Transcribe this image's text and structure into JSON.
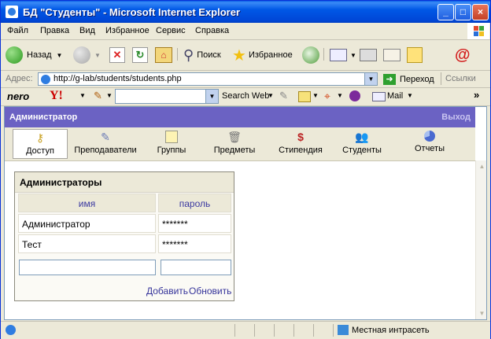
{
  "window": {
    "title": "БД \"Студенты\" - Microsoft Internet Explorer"
  },
  "menu": [
    "Файл",
    "Правка",
    "Вид",
    "Избранное",
    "Сервис",
    "Справка"
  ],
  "toolbar": {
    "back": "Назад",
    "search": "Поиск",
    "favorites": "Избранное"
  },
  "address": {
    "label": "Адрес:",
    "url": "http://g-lab/students/students.php",
    "go": "Переход",
    "links": "Ссылки"
  },
  "toolbar3": {
    "nero": "nero",
    "yahoo": "Y!",
    "search_web": "Search Web",
    "mail": "Mail"
  },
  "page": {
    "header": {
      "user": "Администратор",
      "logout": "Выход"
    },
    "nav": [
      {
        "label": "Доступ",
        "icon": "keys-icon"
      },
      {
        "label": "Преподаватели",
        "icon": "pencil-icon"
      },
      {
        "label": "Группы",
        "icon": "calendar-icon"
      },
      {
        "label": "Предметы",
        "icon": "trash-icon"
      },
      {
        "label": "Стипендия",
        "icon": "dollar-icon"
      },
      {
        "label": "Студенты",
        "icon": "users-icon"
      },
      {
        "label": "Отчеты",
        "icon": "pie-chart-icon"
      }
    ],
    "panel": {
      "title": "Администраторы",
      "columns": [
        "имя",
        "пароль"
      ],
      "rows": [
        {
          "name": "Администратор",
          "password": "*******"
        },
        {
          "name": "Тест",
          "password": "*******"
        }
      ],
      "new_name": "",
      "new_password": "",
      "add": "Добавить",
      "refresh": "Обновить"
    }
  },
  "status": {
    "zone": "Местная интрасеть"
  }
}
